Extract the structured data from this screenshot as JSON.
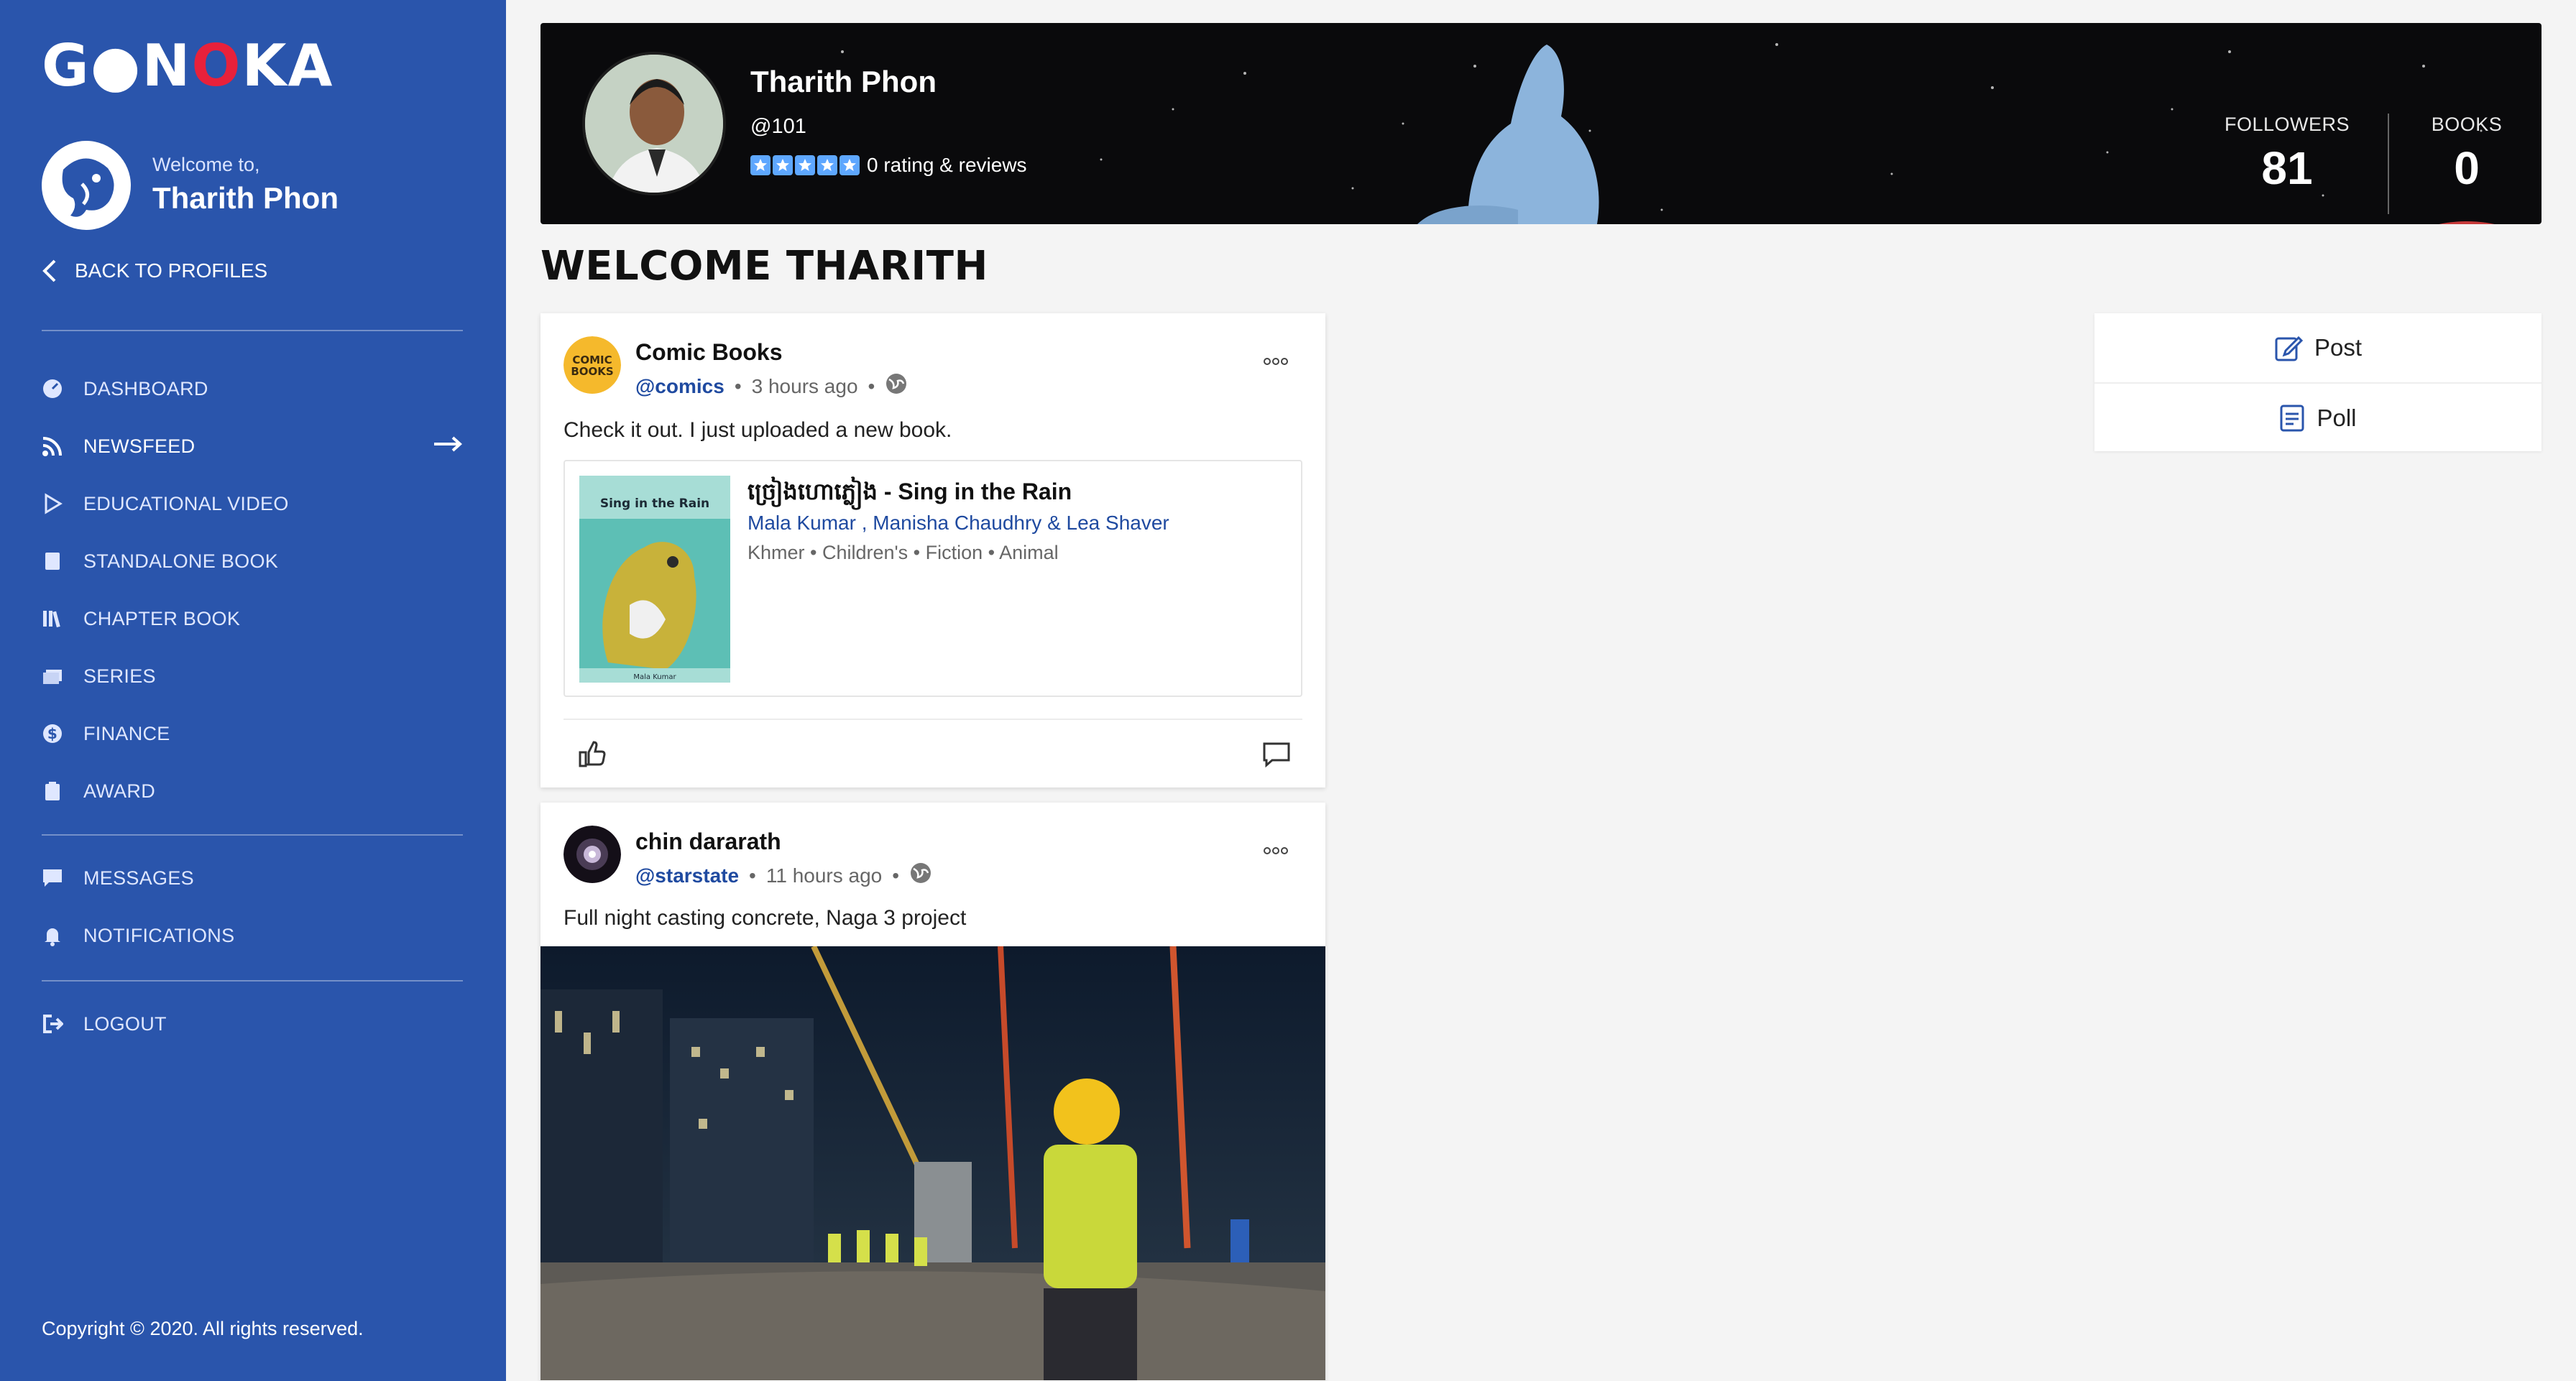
{
  "brand": {
    "logo_text_1": "G",
    "logo_text_2": "N",
    "logo_text_3": "KA"
  },
  "sidebar": {
    "welcome_text": "Welcome to,",
    "user_name": "Tharith Phon",
    "back_label": "BACK TO PROFILES",
    "items": [
      {
        "label": "DASHBOARD",
        "icon": "dashboard-icon"
      },
      {
        "label": "NEWSFEED",
        "icon": "rss-icon",
        "active": true
      },
      {
        "label": "EDUCATIONAL VIDEO",
        "icon": "play-icon"
      },
      {
        "label": "STANDALONE BOOK",
        "icon": "book-icon"
      },
      {
        "label": "CHAPTER BOOK",
        "icon": "library-icon"
      },
      {
        "label": "SERIES",
        "icon": "stack-icon"
      },
      {
        "label": "FINANCE",
        "icon": "dollar-icon"
      },
      {
        "label": "AWARD",
        "icon": "clipboard-icon"
      }
    ],
    "secondary": [
      {
        "label": "MESSAGES",
        "icon": "message-icon"
      },
      {
        "label": "NOTIFICATIONS",
        "icon": "bell-icon"
      }
    ],
    "logout_label": "LOGOUT",
    "copyright": "Copyright © 2020. All rights reserved."
  },
  "profile": {
    "name": "Tharith Phon",
    "handle": "@101",
    "rating_text": "0 rating & reviews",
    "followers_label": "FOLLOWERS",
    "followers_value": "81",
    "books_label": "BOOKS",
    "books_value": "0"
  },
  "page": {
    "title": "WELCOME THARITH"
  },
  "posts": [
    {
      "author": "Comic Books",
      "handle": "@comics",
      "time": "3 hours ago",
      "text": "Check it out. I just uploaded a new book.",
      "book": {
        "title": "ច្រៀងហោភ្លៀង - Sing in the Rain",
        "authors": "Mala Kumar , Manisha Chaudhry & Lea Shaver",
        "tags": "Khmer • Children's • Fiction • Animal",
        "cover_title": "Sing in the Rain",
        "cover_author": "Mala Kumar"
      }
    },
    {
      "author": "chin dararath",
      "handle": "@starstate",
      "time": "11 hours ago",
      "text": "Full night casting concrete, Naga 3 project"
    }
  ],
  "composer": {
    "post_label": "Post",
    "poll_label": "Poll"
  },
  "colors": {
    "sidebar": "#2a55ac",
    "accent_link": "#1f4aa0",
    "logo_red": "#e8213b"
  }
}
